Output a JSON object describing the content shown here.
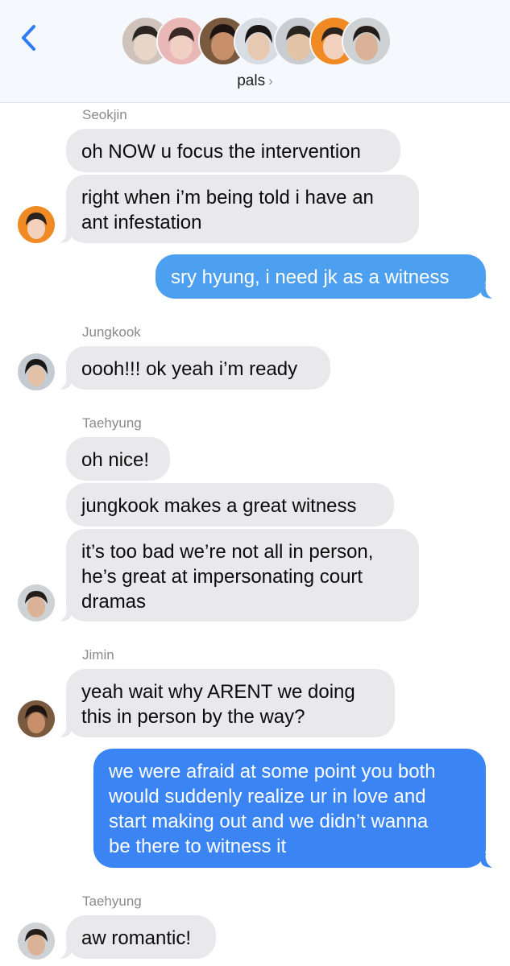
{
  "header": {
    "group_name": "pals",
    "chevron": "›",
    "back_icon": "chevron-left-icon",
    "accent": "#2f7cf6"
  },
  "members": [
    {
      "name": "member-1-avatar",
      "bg": "#cfc3bb",
      "face": "#e8d6c8",
      "hair": "#2b2522"
    },
    {
      "name": "member-2-avatar",
      "bg": "#e9b7b6",
      "face": "#f1d0c4",
      "hair": "#3a2a25"
    },
    {
      "name": "member-3-avatar",
      "bg": "#7a5a3e",
      "face": "#c8906a",
      "hair": "#1e1512"
    },
    {
      "name": "member-4-avatar",
      "bg": "#d8dde3",
      "face": "#e7c9b1",
      "hair": "#1a1614"
    },
    {
      "name": "member-5-avatar",
      "bg": "#c9cdd1",
      "face": "#e2c3a6",
      "hair": "#2a2420"
    },
    {
      "name": "member-6-avatar",
      "bg": "#f08a24",
      "face": "#f2d2bf",
      "hair": "#2b2320"
    },
    {
      "name": "member-7-avatar",
      "bg": "#cfd2d4",
      "face": "#d9b297",
      "hair": "#231c19"
    }
  ],
  "messages": {
    "sender_seokjin": "Seokjin",
    "m1": "oh NOW u focus the intervention",
    "m2": "right when i’m being told i have an\nant infestation",
    "m3": "sry hyung, i need jk as a witness",
    "sender_jungkook": "Jungkook",
    "m4": "oooh!!! ok yeah i’m ready",
    "sender_taehyung": "Taehyung",
    "m5": "oh nice!",
    "m6": "jungkook makes a great witness",
    "m7": "it’s too bad we’re not all in person,\nhe’s great at impersonating court\ndramas",
    "sender_jimin": "Jimin",
    "m8": "yeah wait why ARENT we doing\nthis in person by the way?",
    "m9": "we were afraid at some point you both\nwould suddenly realize ur in love and\nstart making out and we didn’t wanna\nbe there to witness it",
    "sender_taehyung2": "Taehyung",
    "m10": "aw romantic!"
  },
  "colors": {
    "incoming_bubble": "#e9e9eb",
    "outgoing_bubble": "#4d9ff0",
    "outgoing_bubble_dark": "#3a84f3",
    "sender_name": "#8a8a8e"
  }
}
